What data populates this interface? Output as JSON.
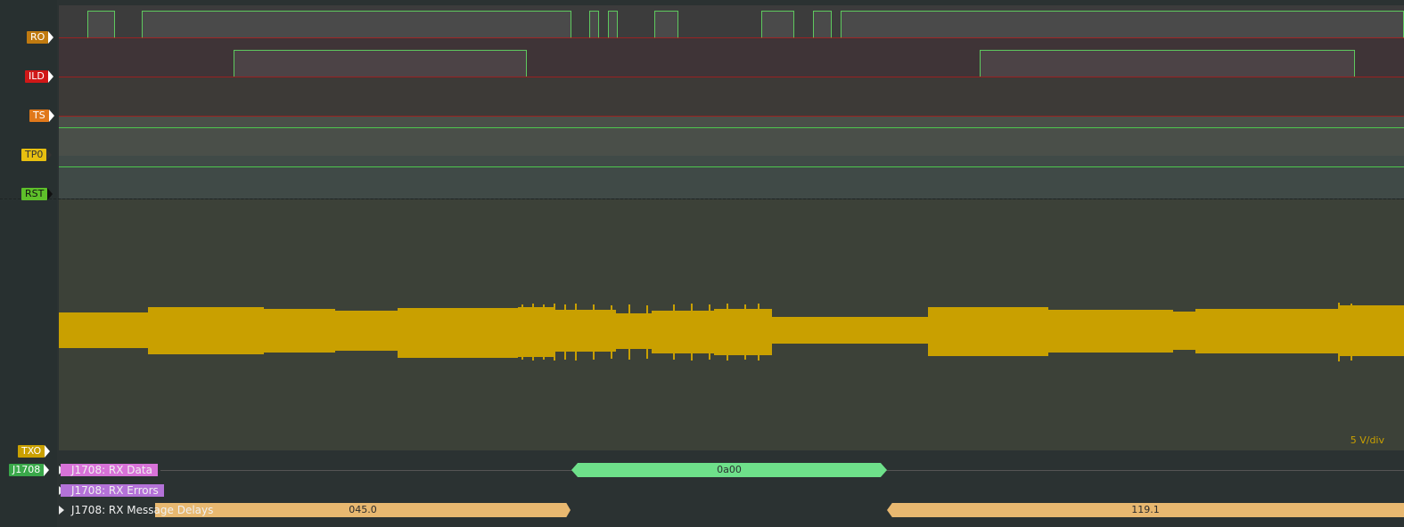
{
  "channels": [
    {
      "name": "RO",
      "color": "#c07a10"
    },
    {
      "name": "ILD",
      "color": "#d01818"
    },
    {
      "name": "TS",
      "color": "#e0781a"
    },
    {
      "name": "TP0",
      "color": "#e8c010"
    },
    {
      "name": "RST",
      "color": "#5ec02a"
    },
    {
      "name": "TXO",
      "color": "#c9a000"
    },
    {
      "name": "J1708",
      "color": "#3aa84a"
    }
  ],
  "scale_label": "5 V/div",
  "decoders": [
    {
      "label": "J1708: RX Data",
      "color": "#d872d8",
      "values": [
        {
          "text": "0a00",
          "color": "#6ee08a"
        }
      ]
    },
    {
      "label": "J1708: RX Errors",
      "color": "#b472d8",
      "values": []
    },
    {
      "label": "J1708: RX Message Delays",
      "color": "#e8b870",
      "values": [
        {
          "text": "045.0"
        },
        {
          "text": "119.1"
        }
      ]
    }
  ]
}
